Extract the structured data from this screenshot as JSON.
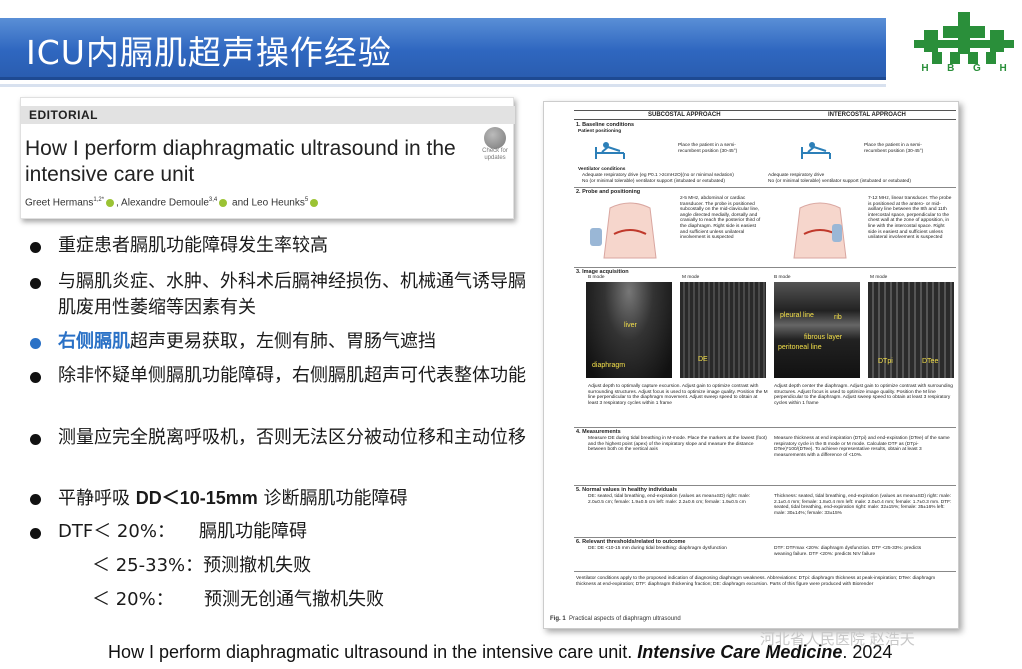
{
  "slide": {
    "title": "ICU内膈肌超声操作经验",
    "logo_letters": [
      "H",
      "B",
      "G",
      "H"
    ],
    "colors": {
      "banner": "#2f67c0",
      "highlight": "#2a71c6",
      "logo_green": "#2a8f3a"
    }
  },
  "editorial": {
    "tag": "EDITORIAL",
    "title": "How I perform diaphragmatic ultrasound in the intensive care unit",
    "authors_1": "Greet Hermans",
    "authors_1_sup": "1,2*",
    "authors_2": ", Alexandre Demoule",
    "authors_2_sup": "3,4",
    "authors_3": " and Leo Heunks",
    "authors_3_sup": "5",
    "badge_text": "Check for updates"
  },
  "bullets": [
    {
      "text": "重症患者膈肌功能障碍发生率较高"
    },
    {
      "text": "与膈肌炎症、水肿、外科术后膈神经损伤、机械通气诱导膈肌废用性萎缩等因素有关"
    },
    {
      "highlight": "右侧膈肌",
      "text": "超声更易获取，左侧有肺、胃肠气遮挡"
    },
    {
      "text": "除非怀疑单侧膈肌功能障碍，右侧膈肌超声可代表整体功能"
    },
    {
      "text": "测量应完全脱离呼吸机，否则无法区分被动位移和主动位移"
    },
    {
      "prefix": "平静呼吸 ",
      "bold": "DD＜10-15mm",
      "suffix": " 诊断膈肌功能障碍"
    },
    {
      "prefix": "DTF＜ 20%：",
      "suffix": "膈肌功能障碍"
    }
  ],
  "sub_bullets": [
    {
      "prefix": "＜ 25-33%：",
      "text": "预测撤机失败"
    },
    {
      "prefix": "＜ 20%：",
      "text": "预测无创通气撤机失败"
    }
  ],
  "figure": {
    "col_subcostal": "SUBCOSTAL APPROACH",
    "col_intercostal": "INTERCOSTAL APPROACH",
    "s1_title": "1. Baseline conditions",
    "s1_sub": "Patient positioning",
    "s1_pos": "Place the patient in a semi-recumbent position (30-45°)",
    "s1_vent": "Ventilator conditions",
    "s1_a": "Adequate respiratory drive (eg P0.1 >2cmH2O)(no or minimal sedation)",
    "s1_b": "No (or minimal tolerable) ventilator support (intubated or extubated)",
    "s1_ia": "Adequate respiratory drive",
    "s1_ib": "No (or minimal tolerable) ventilator support (intubated or extubated)",
    "s2_title": "2. Probe and positioning",
    "s2_sub": "2-5 MHz, abdominal or cardiac transducer. The probe is positioned subcostally on the mid-clavicular line, angle directed medially, dorsally and cranially to reach the posterior third of the diaphragm. Right side is easiest and sufficient unless unilateral involvement is suspected",
    "s2_int": "7-12 MHz, linear transducer. The probe is positioned at the antero- or mid-axillary line between the 8th and 11th intercostal space, perpendicular to the chest wall at the zone of apposition, in line with the intercostal space. Right side is easiest and sufficient unless unilateral involvement is suspected",
    "s3_title": "3. Image acquisition",
    "bmode": "B mode",
    "mmode": "M mode",
    "lbl_liver": "liver",
    "lbl_diaphragm": "diaphragm",
    "lbl_de": "DE",
    "lbl_pleural": "pleural line",
    "lbl_rib": "rib",
    "lbl_fibrous": "fibrous layer",
    "lbl_peritoneal": "peritoneal line",
    "lbl_dtpi": "DTpi",
    "lbl_dtee": "DTee",
    "s3_sub": "Adjust depth to optimally capture excursion. Adjust gain to optimize contrast with surrounding structures. Adjust focus is used to optimize image quality. Position the M line perpendicular to the diaphragm movement. Adjust sweep speed to obtain at least 3 respiratory cycles within 1 frame",
    "s3_int": "Adjust depth center the diaphragm. Adjust gain to optimize contrast with surrounding structures. Adjust focus is used to optimize image quality. Position the M line perpendicular to the diaphragm. Adjust sweep speed to obtain at least 3 respiratory cycles within 1 frame",
    "s4_title": "4. Measurements",
    "s4_sub": "Measure DE during tidal breathing in M-mode. Place the markers at the lowest (foot) and the highest point (apex) of the inspiratory slope and measure the distance between both on the vertical axis",
    "s4_int": "Measure thickness at end inspiration (DTpi) and end-expiration (DTee) of the same respiratory cycle in the B mode or M mode. Calculate DTF as (DTpi-DTee)*100/(DTee). To achieve representative results, obtain at least 3 measurements with a difference of <10%.",
    "s5_title": "5. Normal values in healthy individuals",
    "s5_sub": "DE: seated, tidal breathing, end-expiration (values as mean±SD) right: male: 2.0±0.5 cm; female: 1.9±0.5 cm left: male: 2.2±0.6 cm; female: 1.9±0.5 cm",
    "s5_int": "Thickness: seated, tidal breathing, end-expiration (values as mean±SD) right: male: 2.1±0.4 mm; female: 1.8±0.4 mm left: male: 2.0±0.4 mm; female: 1.7±0.3 mm. DTF: seated, tidal breathing, end-expiration right: male: 32±15%; female: 35±16% left: male: 30±14%; female: 33±15%",
    "s6_title": "6. Relevant thresholds/related to outcome",
    "s6_sub": "DE: DE <10-15 mm during tidal breathing: diaphragm dysfunction",
    "s6_int": "DTF: DTFmax <20%: diaphragm dysfunction. DTF <25-33%: predicts weaning failure. DTF <20%: predicts NIV failure",
    "footnote": "Ventilator conditions apply to the proposed indication of diagnosing diaphragm weakness. Abbreviations: DTpi: diaphragm thickness at peak-inspiration; DTee: diaphragm thickness at end-expiration; DTF: diaphragm thickening fraction; DE: diaphragm excursion. Parts of this figure were produced with Biorender",
    "caption_label": "Fig. 1",
    "caption_text": "Practical aspects of diaphragm ultrasound"
  },
  "footer": {
    "caption": "How I perform diaphragmatic ultrasound in the intensive care unit. ",
    "journal": "Intensive Care Medicine",
    "year": ". 2024",
    "watermark": "河北省人民医院  赵浩天"
  }
}
